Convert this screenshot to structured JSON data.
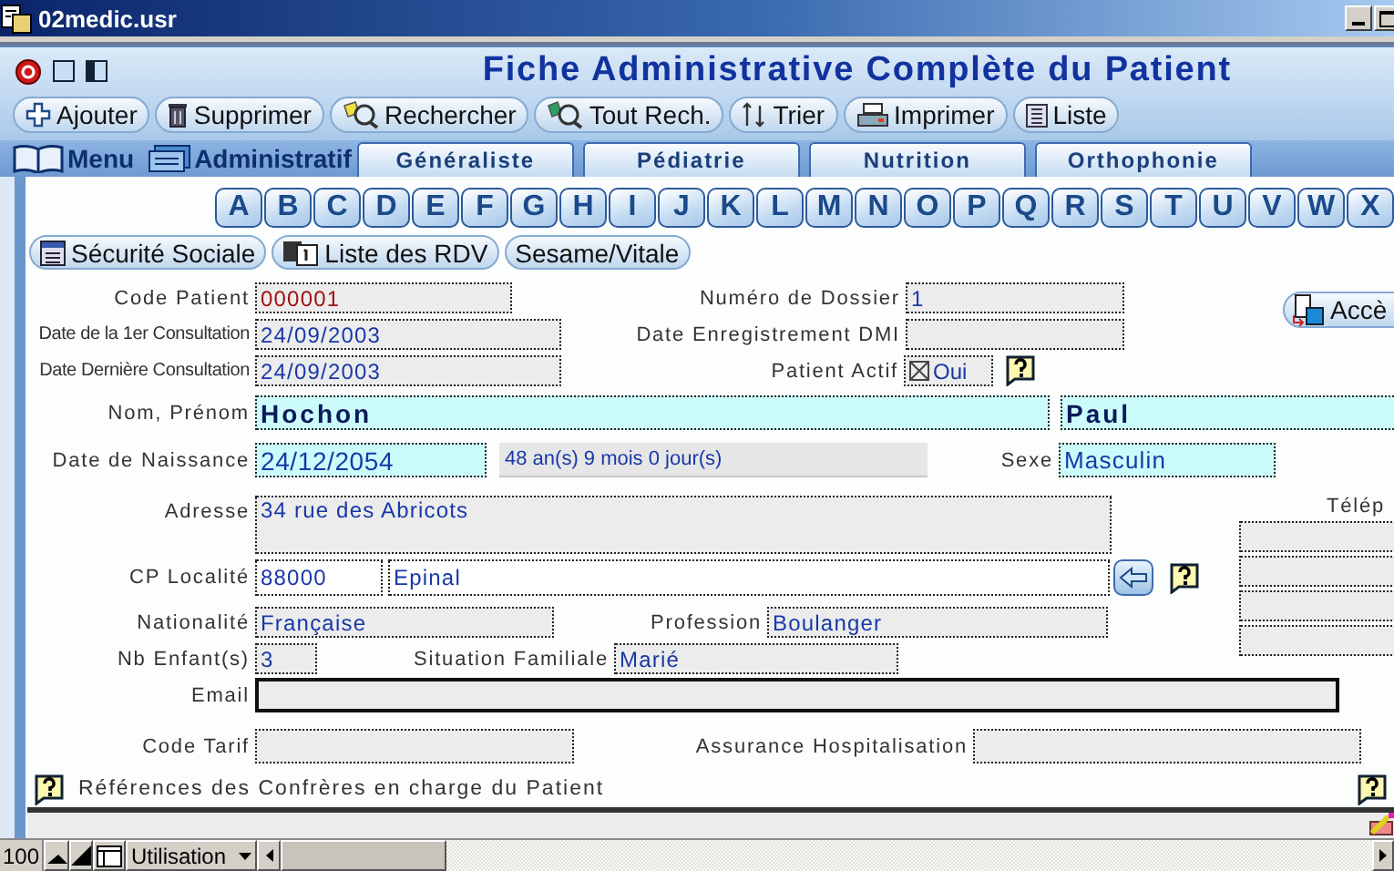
{
  "window": {
    "title": "02medic.usr"
  },
  "header": {
    "title": "Fiche Administrative Complète du Patient"
  },
  "toolbar": [
    {
      "label": "Ajouter",
      "kind": "add"
    },
    {
      "label": "Supprimer",
      "kind": "delete"
    },
    {
      "label": "Rechercher",
      "kind": "search"
    },
    {
      "label": "Tout Rech.",
      "kind": "search_all"
    },
    {
      "label": "Trier",
      "kind": "sort"
    },
    {
      "label": "Imprimer",
      "kind": "print"
    },
    {
      "label": "Liste",
      "kind": "list"
    }
  ],
  "nav": [
    {
      "label": "Menu",
      "kind": "book"
    },
    {
      "label": "Administratif",
      "kind": "window"
    }
  ],
  "tabs": [
    {
      "label": "Généraliste",
      "selected": false
    },
    {
      "label": "Pédiatrie",
      "selected": false
    },
    {
      "label": "Nutrition",
      "selected": false
    },
    {
      "label": "Orthophonie",
      "selected": false
    }
  ],
  "letters": [
    "A",
    "B",
    "C",
    "D",
    "E",
    "F",
    "G",
    "H",
    "I",
    "J",
    "K",
    "L",
    "M",
    "N",
    "O",
    "P",
    "Q",
    "R",
    "S",
    "T",
    "U",
    "V",
    "W",
    "X"
  ],
  "sections": [
    {
      "label": "Sécurité Sociale",
      "kind": "card"
    },
    {
      "label": "Liste des RDV",
      "kind": "calendar"
    },
    {
      "label": "Sesame/Vitale",
      "kind": "plain"
    }
  ],
  "access_button": {
    "label": "Accè"
  },
  "form": {
    "code_patient": {
      "label": "Code Patient",
      "value": "000001"
    },
    "numero_dossier": {
      "label": "Numéro de Dossier",
      "value": "1"
    },
    "first_consultation": {
      "label": "Date de la 1er Consultation",
      "value": "24/09/2003"
    },
    "date_dmi": {
      "label": "Date Enregistrement DMI"
    },
    "last_consultation": {
      "label": "Date Dernière Consultation",
      "value": "24/09/2003"
    },
    "patient_actif": {
      "label": "Patient Actif",
      "value": "Oui",
      "checked": true
    },
    "nom_prenom": {
      "label": "Nom, Prénom",
      "last_name": "Hochon",
      "first_name": "Paul"
    },
    "date_naissance": {
      "label": "Date de Naissance",
      "value": "24/12/2054",
      "age": "48 an(s) 9 mois 0 jour(s)"
    },
    "sexe": {
      "label": "Sexe",
      "value": "Masculin"
    },
    "adresse": {
      "label": "Adresse",
      "value": "34 rue des Abricots"
    },
    "telephone": {
      "label": "Télép"
    },
    "cp_localite": {
      "label": "CP Localité",
      "postal_code": "88000",
      "city": "Epinal"
    },
    "nationalite": {
      "label": "Nationalité",
      "value": "Française"
    },
    "profession": {
      "label": "Profession",
      "value": "Boulanger"
    },
    "nb_enfants": {
      "label": "Nb Enfant(s)",
      "value": "3"
    },
    "situation_familiale": {
      "label": "Situation Familiale",
      "value": "Marié"
    },
    "email": {
      "label": "Email"
    },
    "code_tarif": {
      "label": "Code Tarif"
    },
    "assurance": {
      "label": "Assurance Hospitalisation"
    }
  },
  "references": {
    "label": "Références des Confrères en charge du Patient"
  },
  "status_bar": {
    "zoom": "100",
    "mode": "Utilisation"
  }
}
